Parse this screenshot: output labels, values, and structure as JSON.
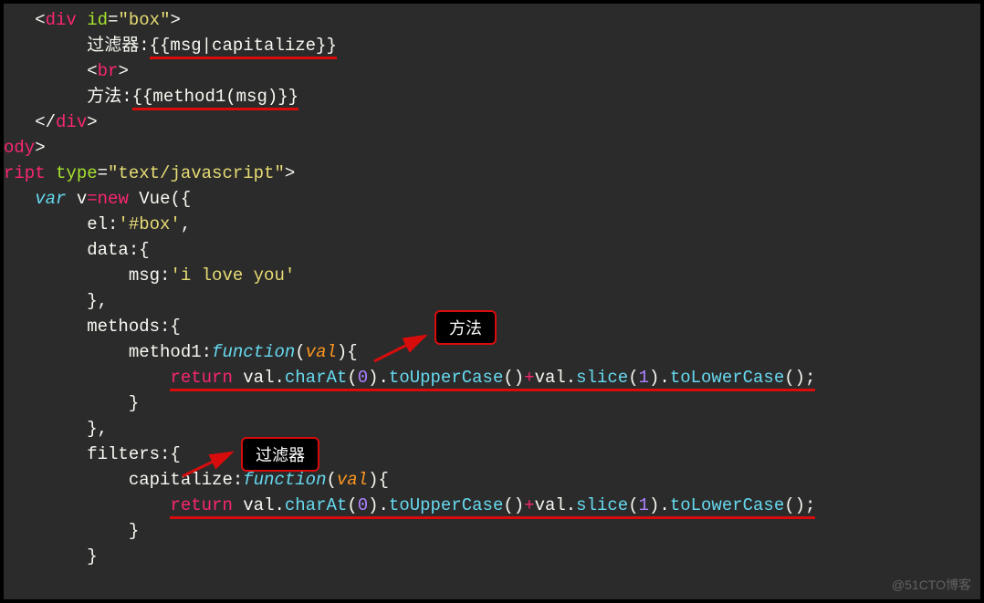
{
  "code": {
    "l1_open": "<",
    "l1_tag": "div",
    "l1_attr": "id",
    "l1_eq": "=",
    "l1_val": "\"box\"",
    "l1_close": ">",
    "l2_label": "过滤器:",
    "l2_expr": "{{msg|capitalize}}",
    "l3_open": "<",
    "l3_tag": "br",
    "l3_close": ">",
    "l4_label": "方法:",
    "l4_expr": "{{method1(msg)}}",
    "l5_open": "</",
    "l5_tag": "div",
    "l5_close": ">",
    "l6_frag": "ody",
    "l6_close": ">",
    "l7_frag": "ript",
    "l7_attr": "type",
    "l7_eq": "=",
    "l7_val": "\"text/javascript\"",
    "l7_close": ">",
    "l8_var": "var",
    "l8_vname": " v",
    "l8_eq": "=",
    "l8_new": "new",
    "l8_vue": " Vue({",
    "l9": "        el:",
    "l9_val": "'#box'",
    "l9_comma": ",",
    "l10": "        data:{",
    "l11": "            msg:",
    "l11_val": "'i love you'",
    "l12": "        },",
    "l13": "        methods:{",
    "l14": "            method1:",
    "l14_fn": "function",
    "l14_p": "(",
    "l14_arg": "val",
    "l14_p2": "){",
    "l15_indent": "                ",
    "l15_ret": "return",
    "l15_a": " val.",
    "l15_c1": "charAt",
    "l15_p1": "(",
    "l15_n0": "0",
    "l15_p2": ").",
    "l15_c2": "toUpperCase",
    "l15_p3": "()",
    "l15_plus": "+",
    "l15_b": "val.",
    "l15_c3": "slice",
    "l15_p4": "(",
    "l15_n1": "1",
    "l15_p5": ").",
    "l15_c4": "toLowerCase",
    "l15_p6": "();",
    "l16": "            }",
    "l17": "        },",
    "l18": "        filters:{",
    "l19": "            capitalize:",
    "l19_fn": "function",
    "l19_p": "(",
    "l19_arg": "val",
    "l19_p2": "){",
    "l20_indent": "                ",
    "l21": "            }",
    "l22": "        }"
  },
  "callouts": {
    "methods": "方法",
    "filters": "过滤器"
  },
  "watermark": "@51CTO博客"
}
